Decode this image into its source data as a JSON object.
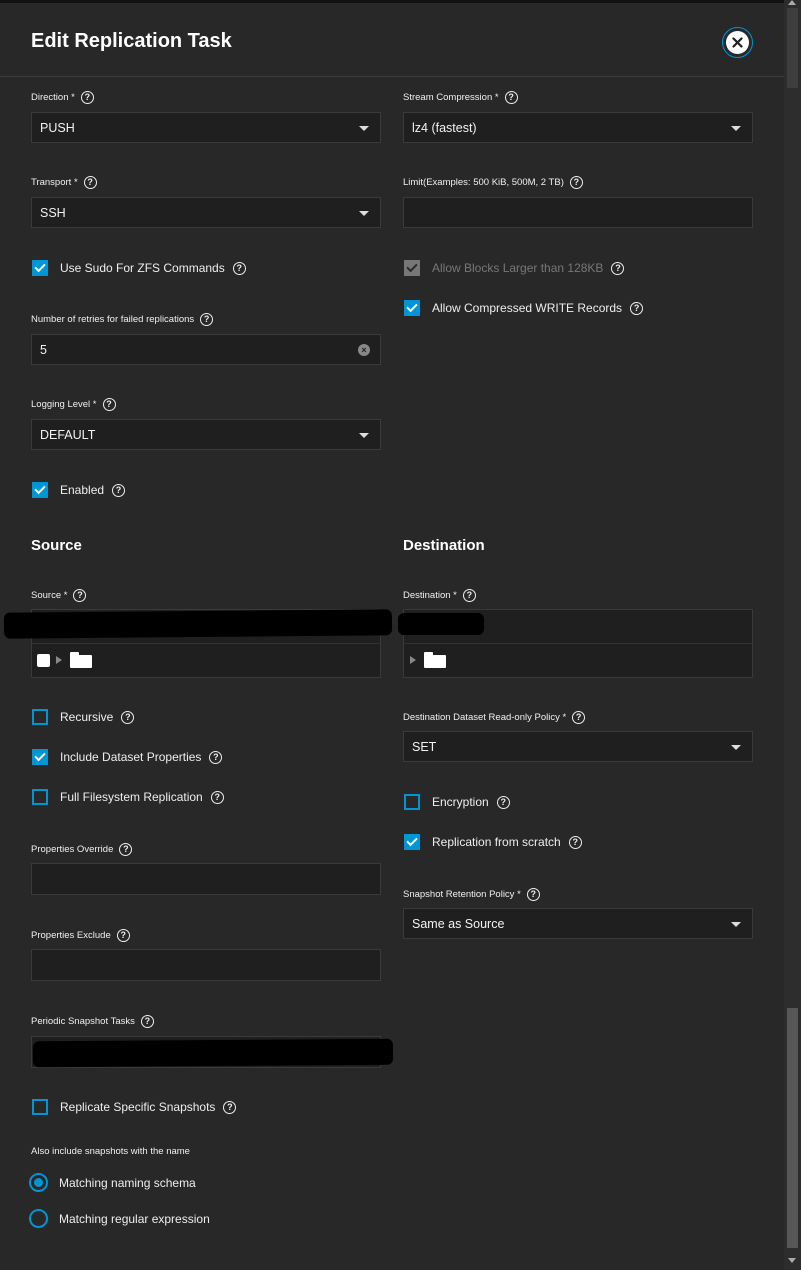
{
  "dialog": {
    "title": "Edit Replication Task"
  },
  "fields": {
    "direction": {
      "label": "Direction *",
      "value": "PUSH"
    },
    "transport": {
      "label": "Transport *",
      "value": "SSH"
    },
    "use_sudo": {
      "label": "Use Sudo For ZFS Commands",
      "checked": true
    },
    "retries": {
      "label": "Number of retries for failed replications",
      "value": "5"
    },
    "logging_level": {
      "label": "Logging Level *",
      "value": "DEFAULT"
    },
    "enabled": {
      "label": "Enabled",
      "checked": true
    },
    "stream_compression": {
      "label": "Stream Compression *",
      "value": "lz4 (fastest)"
    },
    "limit": {
      "label": "Limit(Examples: 500 KiB, 500M, 2 TB)",
      "value": ""
    },
    "allow_blocks_larger": {
      "label": "Allow Blocks Larger than 128KB",
      "checked": true,
      "disabled": true
    },
    "allow_compressed": {
      "label": "Allow Compressed WRITE Records",
      "checked": true
    }
  },
  "source": {
    "heading": "Source",
    "source_label": "Source *",
    "recursive": {
      "label": "Recursive",
      "checked": false
    },
    "include_props": {
      "label": "Include Dataset Properties",
      "checked": true
    },
    "full_fs": {
      "label": "Full Filesystem Replication",
      "checked": false
    },
    "props_override": {
      "label": "Properties Override",
      "value": ""
    },
    "props_exclude": {
      "label": "Properties Exclude",
      "value": ""
    },
    "periodic_tasks": {
      "label": "Periodic Snapshot Tasks"
    },
    "replicate_specific": {
      "label": "Replicate Specific Snapshots",
      "checked": false
    },
    "also_include": {
      "label": "Also include snapshots with the name"
    },
    "radio_options": [
      {
        "label": "Matching naming schema",
        "selected": true
      },
      {
        "label": "Matching regular expression",
        "selected": false
      }
    ]
  },
  "destination": {
    "heading": "Destination",
    "dest_label": "Destination *",
    "readonly_policy": {
      "label": "Destination Dataset Read-only Policy *",
      "value": "SET"
    },
    "encryption": {
      "label": "Encryption",
      "checked": false
    },
    "from_scratch": {
      "label": "Replication from scratch",
      "checked": true
    },
    "retention": {
      "label": "Snapshot Retention Policy *",
      "value": "Same as Source"
    }
  },
  "icons": {
    "help": "help-circle-icon",
    "close": "close-icon",
    "folder": "folder-icon"
  },
  "colors": {
    "accent": "#0095d5",
    "background": "#282828",
    "field": "#1f1f1f"
  }
}
